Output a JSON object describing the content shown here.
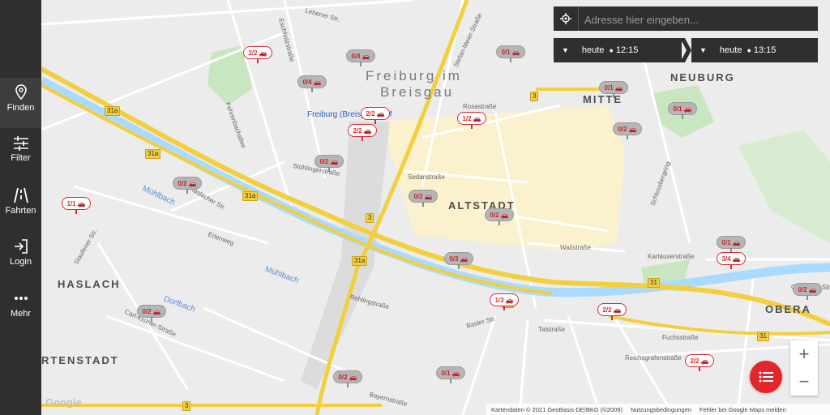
{
  "sidebar": {
    "items": [
      {
        "label": "Finden",
        "icon": "map-pin-icon"
      },
      {
        "label": "Filter",
        "icon": "sliders-icon"
      },
      {
        "label": "Fahrten",
        "icon": "road-icon"
      },
      {
        "label": "Login",
        "icon": "login-icon"
      },
      {
        "label": "Mehr",
        "icon": "more-dots-icon"
      }
    ]
  },
  "search": {
    "placeholder": "Adresse hier eingeben..."
  },
  "time_range": {
    "from": {
      "day": "heute",
      "time": "12:15"
    },
    "to": {
      "day": "heute",
      "time": "13:15"
    }
  },
  "map": {
    "city_label_line1": "Freiburg im",
    "city_label_line2": "Breisgau",
    "districts": {
      "mitte": "MITTE",
      "neuburg": "NEUBURG",
      "altstadt": "ALTSTADT",
      "haslach": "HASLACH",
      "oberau": "OBERA",
      "gartenstadt": "RTENSTADT"
    },
    "station": "Freiburg (Breisgau) Hbf",
    "water": {
      "muehlbach1": "Mühlbach",
      "muehlbach2": "Mühlbach",
      "dorfbach": "Dorfbach"
    },
    "streets": {
      "s1": "Eschholzstraße",
      "s2": "Stefan-Meier-Straße",
      "s3": "Haslacher Str.",
      "s4": "Talstraße",
      "s5": "Basler Str.",
      "s6": "Kartäuserstraße",
      "s7": "Carl-Kistner-Straße",
      "s8": "Rehlingstraße",
      "s9": "Schlossbergring",
      "s10": "Stühlingerstraße",
      "s11": "Reichsgrafenstraße",
      "s12": "Fuchsstraße",
      "s13": "Wallstraße",
      "s14": "Rosastraße",
      "s15": "Lehener Str.",
      "s16": "Otto-Weis-Str.",
      "s17": "Staufener Str.",
      "s18": "Erlenweg",
      "s19": "Fehrenbachallee",
      "s20": "Sedanstraße",
      "s21": "Bayernstraße"
    },
    "road_shields": {
      "r1": "31a",
      "r2": "31a",
      "r3": "31a",
      "r4": "31a",
      "r5": "3",
      "r6": "3",
      "r7": "31",
      "r8": "31",
      "r9": "31",
      "r10": "3"
    },
    "pins": [
      {
        "label": "2/2",
        "state": "full"
      },
      {
        "label": "0/4",
        "state": "empty"
      },
      {
        "label": "0/1",
        "state": "empty"
      },
      {
        "label": "0/4",
        "state": "empty"
      },
      {
        "label": "2/2",
        "state": "full"
      },
      {
        "label": "2/2",
        "state": "full"
      },
      {
        "label": "1/2",
        "state": "full"
      },
      {
        "label": "0/1",
        "state": "empty"
      },
      {
        "label": "0/1",
        "state": "empty"
      },
      {
        "label": "0/2",
        "state": "empty"
      },
      {
        "label": "0/2",
        "state": "empty"
      },
      {
        "label": "0/2",
        "state": "empty"
      },
      {
        "label": "1/1",
        "state": "full"
      },
      {
        "label": "0/2",
        "state": "empty"
      },
      {
        "label": "0/2",
        "state": "empty"
      },
      {
        "label": "0/3",
        "state": "empty"
      },
      {
        "label": "0/1",
        "state": "empty"
      },
      {
        "label": "3/4",
        "state": "full"
      },
      {
        "label": "1/3",
        "state": "full"
      },
      {
        "label": "2/2",
        "state": "full"
      },
      {
        "label": "0/2",
        "state": "empty"
      },
      {
        "label": "0/2",
        "state": "empty"
      },
      {
        "label": "0/1",
        "state": "empty"
      },
      {
        "label": "2/2",
        "state": "full"
      },
      {
        "label": "0/2",
        "state": "empty"
      }
    ]
  },
  "attribution": {
    "google": "Google",
    "mapdata": "Kartendaten © 2021 GeoBasis-DE/BKG (©2009)",
    "terms": "Nutzungsbedingungen",
    "report": "Fehler bei Google Maps melden"
  },
  "colors": {
    "accent": "#e2262c",
    "sidebar": "#2f2f2f",
    "river": "#aadaff",
    "road": "#f3cf3d"
  }
}
